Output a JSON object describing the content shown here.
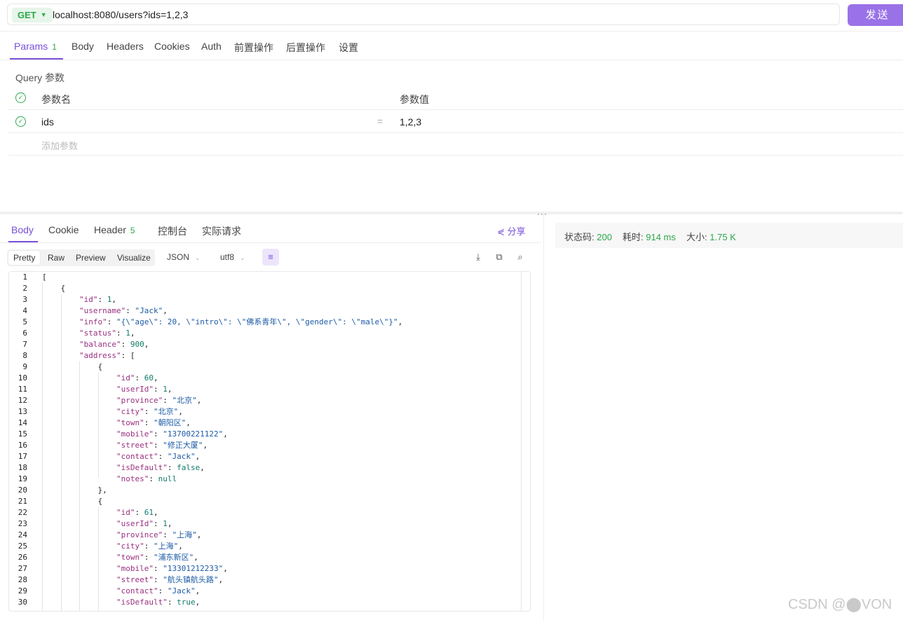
{
  "request": {
    "method": "GET",
    "url": "localhost:8080/users?ids=1,2,3",
    "send_label": "发送"
  },
  "request_tabs": [
    {
      "label": "Params",
      "badge": "1"
    },
    {
      "label": "Body"
    },
    {
      "label": "Headers"
    },
    {
      "label": "Cookies"
    },
    {
      "label": "Auth"
    },
    {
      "label": "前置操作"
    },
    {
      "label": "后置操作"
    },
    {
      "label": "设置"
    }
  ],
  "query": {
    "title": "Query 参数",
    "col_name": "参数名",
    "col_value": "参数值",
    "rows": [
      {
        "name": "ids",
        "value": "1,2,3"
      }
    ],
    "eq": "=",
    "add_placeholder": "添加参数"
  },
  "response_tabs": [
    {
      "label": "Body"
    },
    {
      "label": "Cookie"
    },
    {
      "label": "Header",
      "badge": "5"
    },
    {
      "label": "控制台"
    },
    {
      "label": "实际请求"
    }
  ],
  "share_label": "分享",
  "view_modes": [
    "Pretty",
    "Raw",
    "Preview",
    "Visualize"
  ],
  "format_select": "JSON",
  "encoding_select": "utf8",
  "status": {
    "code_label": "状态码:",
    "code_value": "200",
    "time_label": "耗时:",
    "time_value": "914 ms",
    "size_label": "大小:",
    "size_value": "1.75 K"
  },
  "code_lines": [
    [
      [
        "p",
        "["
      ]
    ],
    [
      [
        "p",
        "    {"
      ]
    ],
    [
      [
        "p",
        "        "
      ],
      [
        "k",
        "\"id\""
      ],
      [
        "p",
        ": "
      ],
      [
        "n",
        "1"
      ],
      [
        "p",
        ","
      ]
    ],
    [
      [
        "p",
        "        "
      ],
      [
        "k",
        "\"username\""
      ],
      [
        "p",
        ": "
      ],
      [
        "s",
        "\"Jack\""
      ],
      [
        "p",
        ","
      ]
    ],
    [
      [
        "p",
        "        "
      ],
      [
        "k",
        "\"info\""
      ],
      [
        "p",
        ": "
      ],
      [
        "s",
        "\"{\\\"age\\\": 20, \\\"intro\\\": \\\"佛系青年\\\", \\\"gender\\\": \\\"male\\\"}\""
      ],
      [
        "p",
        ","
      ]
    ],
    [
      [
        "p",
        "        "
      ],
      [
        "k",
        "\"status\""
      ],
      [
        "p",
        ": "
      ],
      [
        "n",
        "1"
      ],
      [
        "p",
        ","
      ]
    ],
    [
      [
        "p",
        "        "
      ],
      [
        "k",
        "\"balance\""
      ],
      [
        "p",
        ": "
      ],
      [
        "n",
        "900"
      ],
      [
        "p",
        ","
      ]
    ],
    [
      [
        "p",
        "        "
      ],
      [
        "k",
        "\"address\""
      ],
      [
        "p",
        ": ["
      ]
    ],
    [
      [
        "p",
        "            {"
      ]
    ],
    [
      [
        "p",
        "                "
      ],
      [
        "k",
        "\"id\""
      ],
      [
        "p",
        ": "
      ],
      [
        "n",
        "60"
      ],
      [
        "p",
        ","
      ]
    ],
    [
      [
        "p",
        "                "
      ],
      [
        "k",
        "\"userId\""
      ],
      [
        "p",
        ": "
      ],
      [
        "n",
        "1"
      ],
      [
        "p",
        ","
      ]
    ],
    [
      [
        "p",
        "                "
      ],
      [
        "k",
        "\"province\""
      ],
      [
        "p",
        ": "
      ],
      [
        "s",
        "\"北京\""
      ],
      [
        "p",
        ","
      ]
    ],
    [
      [
        "p",
        "                "
      ],
      [
        "k",
        "\"city\""
      ],
      [
        "p",
        ": "
      ],
      [
        "s",
        "\"北京\""
      ],
      [
        "p",
        ","
      ]
    ],
    [
      [
        "p",
        "                "
      ],
      [
        "k",
        "\"town\""
      ],
      [
        "p",
        ": "
      ],
      [
        "s",
        "\"朝阳区\""
      ],
      [
        "p",
        ","
      ]
    ],
    [
      [
        "p",
        "                "
      ],
      [
        "k",
        "\"mobile\""
      ],
      [
        "p",
        ": "
      ],
      [
        "s",
        "\"13700221122\""
      ],
      [
        "p",
        ","
      ]
    ],
    [
      [
        "p",
        "                "
      ],
      [
        "k",
        "\"street\""
      ],
      [
        "p",
        ": "
      ],
      [
        "s",
        "\"修正大厦\""
      ],
      [
        "p",
        ","
      ]
    ],
    [
      [
        "p",
        "                "
      ],
      [
        "k",
        "\"contact\""
      ],
      [
        "p",
        ": "
      ],
      [
        "s",
        "\"Jack\""
      ],
      [
        "p",
        ","
      ]
    ],
    [
      [
        "p",
        "                "
      ],
      [
        "k",
        "\"isDefault\""
      ],
      [
        "p",
        ": "
      ],
      [
        "b",
        "false"
      ],
      [
        "p",
        ","
      ]
    ],
    [
      [
        "p",
        "                "
      ],
      [
        "k",
        "\"notes\""
      ],
      [
        "p",
        ": "
      ],
      [
        "b",
        "null"
      ]
    ],
    [
      [
        "p",
        "            },"
      ]
    ],
    [
      [
        "p",
        "            {"
      ]
    ],
    [
      [
        "p",
        "                "
      ],
      [
        "k",
        "\"id\""
      ],
      [
        "p",
        ": "
      ],
      [
        "n",
        "61"
      ],
      [
        "p",
        ","
      ]
    ],
    [
      [
        "p",
        "                "
      ],
      [
        "k",
        "\"userId\""
      ],
      [
        "p",
        ": "
      ],
      [
        "n",
        "1"
      ],
      [
        "p",
        ","
      ]
    ],
    [
      [
        "p",
        "                "
      ],
      [
        "k",
        "\"province\""
      ],
      [
        "p",
        ": "
      ],
      [
        "s",
        "\"上海\""
      ],
      [
        "p",
        ","
      ]
    ],
    [
      [
        "p",
        "                "
      ],
      [
        "k",
        "\"city\""
      ],
      [
        "p",
        ": "
      ],
      [
        "s",
        "\"上海\""
      ],
      [
        "p",
        ","
      ]
    ],
    [
      [
        "p",
        "                "
      ],
      [
        "k",
        "\"town\""
      ],
      [
        "p",
        ": "
      ],
      [
        "s",
        "\"浦东新区\""
      ],
      [
        "p",
        ","
      ]
    ],
    [
      [
        "p",
        "                "
      ],
      [
        "k",
        "\"mobile\""
      ],
      [
        "p",
        ": "
      ],
      [
        "s",
        "\"13301212233\""
      ],
      [
        "p",
        ","
      ]
    ],
    [
      [
        "p",
        "                "
      ],
      [
        "k",
        "\"street\""
      ],
      [
        "p",
        ": "
      ],
      [
        "s",
        "\"航头镇航头路\""
      ],
      [
        "p",
        ","
      ]
    ],
    [
      [
        "p",
        "                "
      ],
      [
        "k",
        "\"contact\""
      ],
      [
        "p",
        ": "
      ],
      [
        "s",
        "\"Jack\""
      ],
      [
        "p",
        ","
      ]
    ],
    [
      [
        "p",
        "                "
      ],
      [
        "k",
        "\"isDefault\""
      ],
      [
        "p",
        ": "
      ],
      [
        "b",
        "true"
      ],
      [
        "p",
        ","
      ]
    ]
  ],
  "watermark": "CSDN @⬤VON"
}
